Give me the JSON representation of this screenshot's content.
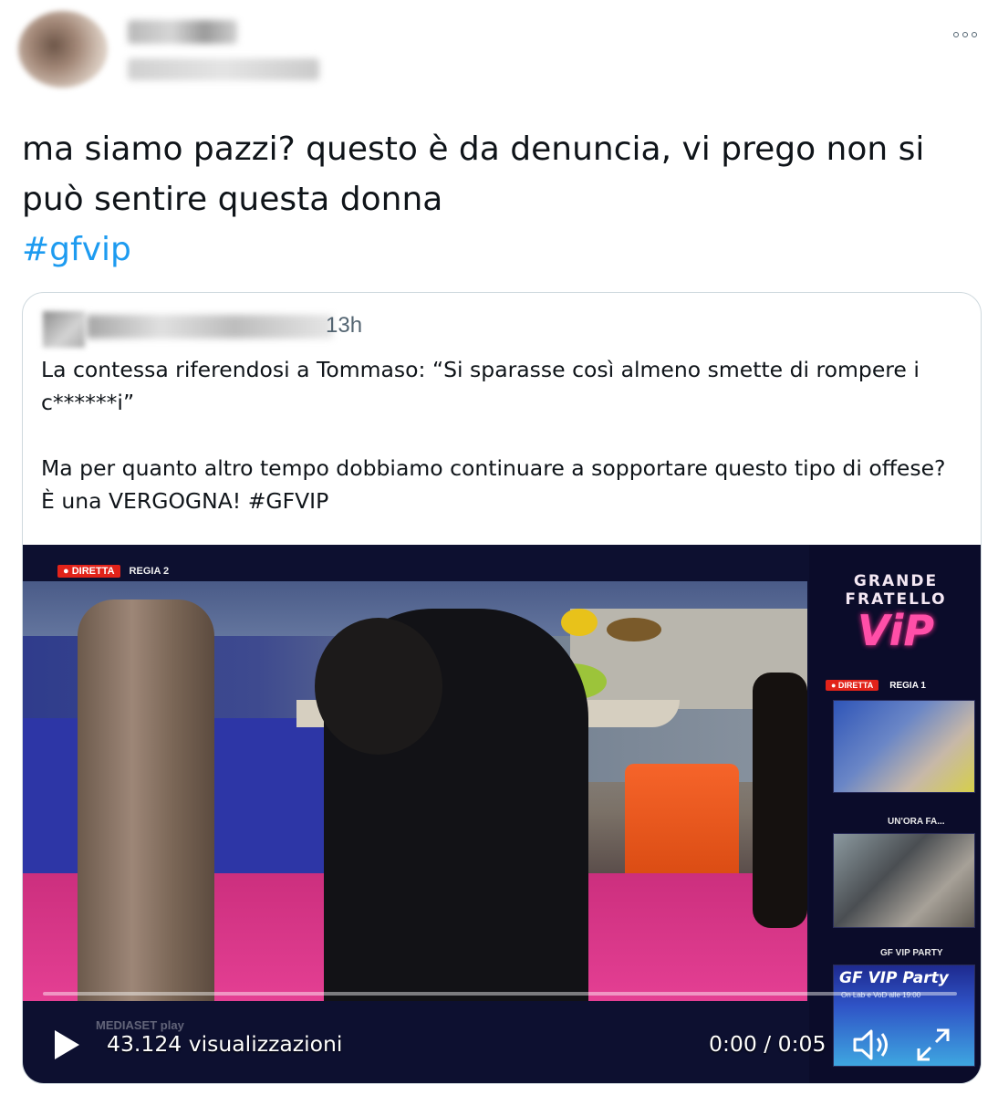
{
  "tweet": {
    "text": "ma siamo pazzi? questo è da denuncia, vi prego non si può sentire questa donna",
    "hashtag": "#gfvip",
    "more_icon": "more-horizontal-icon"
  },
  "quote": {
    "time": "13h",
    "text": "La contessa riferendosi a Tommaso: “Si sparasse così almeno smette di rompere i c******i”\n\nMa per quanto altro tempo dobbiamo continuare a sopportare questo tipo di offese? È una VERGOGNA! #GFVIP"
  },
  "video": {
    "live_label": "● DIRETTA",
    "regia_main": "REGIA 2",
    "logo_top": "GRANDE FRATELLO",
    "logo_vip": "ViP",
    "side_live_label": "● DIRETTA",
    "side_regia": "REGIA 1",
    "side_label_1": "UN'ORA FA...",
    "side_label_2": "GF VIP PARTY",
    "party_title": "GF VIP Party",
    "party_sub": "On Lab e VoD alle 19:00",
    "watermark": "MEDIASET play",
    "progress": 0,
    "views": "43.124 visualizzazioni",
    "timecode": "0:00 / 0:05",
    "icons": {
      "play": "play-icon",
      "volume": "volume-icon",
      "fullscreen": "fullscreen-icon"
    }
  },
  "colors": {
    "text": "#0f1419",
    "hashtag": "#1d9bf0",
    "secondary": "#536471",
    "border": "#cfd9de",
    "live_red": "#e2231a"
  }
}
